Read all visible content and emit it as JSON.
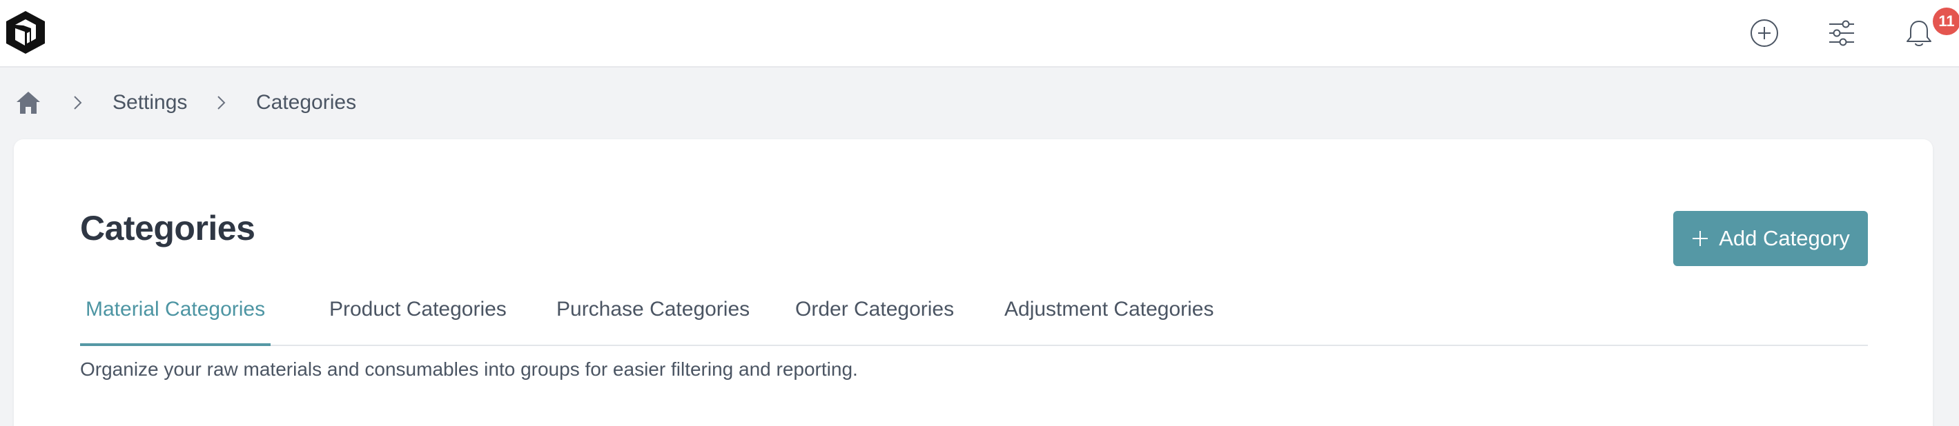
{
  "topbar": {
    "logo_icon": "cube-logo-icon",
    "icons": [
      "plus-circle-icon",
      "sliders-icon",
      "bell-icon"
    ],
    "notification_count": "11",
    "badge_color": "#e4554f"
  },
  "breadcrumb": {
    "home_icon": "home-icon",
    "items": [
      "Settings",
      "Categories"
    ]
  },
  "page": {
    "title": "Categories",
    "add_button_label": "Add Category",
    "accent_color": "#5598a5",
    "tabs": [
      {
        "label": "Material Categories",
        "active": true
      },
      {
        "label": "Product Categories",
        "active": false
      },
      {
        "label": "Purchase Categories",
        "active": false
      },
      {
        "label": "Order Categories",
        "active": false
      },
      {
        "label": "Adjustment Categories",
        "active": false
      }
    ],
    "description": "Organize your raw materials and consumables into groups for easier filtering and reporting."
  }
}
